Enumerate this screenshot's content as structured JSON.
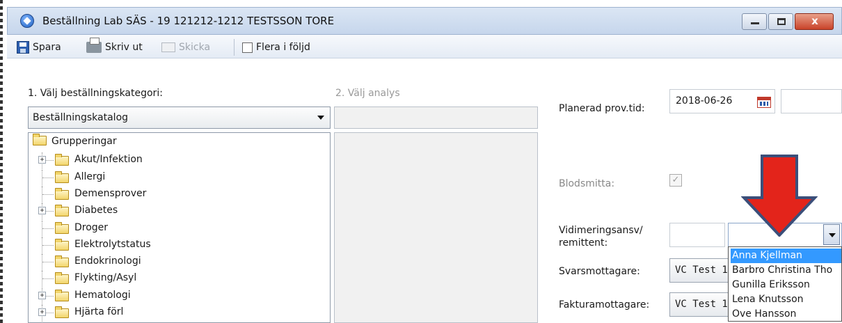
{
  "window": {
    "title": "Beställning Lab SÄS  -  19 121212-1212 TESTSSON TORE",
    "close_glyph": "x"
  },
  "toolbar": {
    "save_label": "Spara",
    "print_label": "Skriv ut",
    "send_label": "Skicka",
    "series_label": "Flera i följd"
  },
  "left": {
    "step1_label": "1. Välj beställningskategori:",
    "step2_label": "2. Välj analys",
    "category_value": "Beställningskatalog",
    "tree": [
      {
        "label": "Grupperingar",
        "level": 0,
        "expander": ""
      },
      {
        "label": "Akut/Infektion",
        "level": 1,
        "expander": "+"
      },
      {
        "label": "Allergi",
        "level": 1,
        "expander": ""
      },
      {
        "label": "Demensprover",
        "level": 1,
        "expander": ""
      },
      {
        "label": "Diabetes",
        "level": 1,
        "expander": "+"
      },
      {
        "label": "Droger",
        "level": 1,
        "expander": ""
      },
      {
        "label": "Elektrolytstatus",
        "level": 1,
        "expander": ""
      },
      {
        "label": "Endokrinologi",
        "level": 1,
        "expander": ""
      },
      {
        "label": "Flykting/Asyl",
        "level": 1,
        "expander": ""
      },
      {
        "label": "Hematologi",
        "level": 1,
        "expander": "+"
      },
      {
        "label": "Hjärta förl",
        "level": 1,
        "expander": "+"
      }
    ]
  },
  "right": {
    "planned_label": "Planerad prov.tid:",
    "planned_date": "2018-06-26",
    "blood_label": "Blodsmitta:",
    "blood_checked": "✓",
    "vid_label_1": "Vidimeringsansv/",
    "vid_label_2": "remittent:",
    "recv_label": "Svarsmottagare:",
    "recv_value": "VC Test 1",
    "invoice_label": "Fakturamottagare:",
    "invoice_value": "VC Test 1"
  },
  "dropdown": {
    "items": [
      {
        "label": "Anna Kjellman",
        "selected": true
      },
      {
        "label": "Barbro Christina Tho",
        "selected": false
      },
      {
        "label": "Gunilla Eriksson",
        "selected": false
      },
      {
        "label": "Lena Knutsson",
        "selected": false
      },
      {
        "label": "Ove Hansson",
        "selected": false
      }
    ]
  },
  "colors": {
    "arrow_fill": "#e3241b",
    "arrow_stroke": "#3b4f7a",
    "selection": "#3399ff"
  }
}
